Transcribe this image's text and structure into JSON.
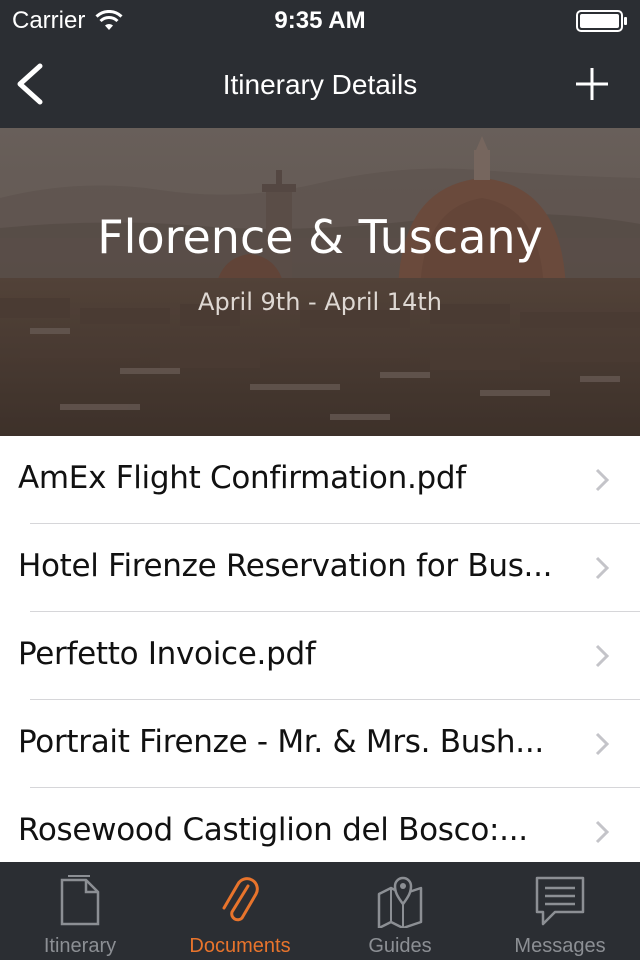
{
  "status_bar": {
    "carrier": "Carrier",
    "time": "9:35 AM"
  },
  "nav": {
    "title": "Itinerary Details"
  },
  "hero": {
    "title": "Florence & Tuscany",
    "dates": "April 9th - April 14th"
  },
  "documents": [
    {
      "label": "AmEx Flight Confirmation.pdf"
    },
    {
      "label": "Hotel Firenze Reservation for Bus..."
    },
    {
      "label": "Perfetto Invoice.pdf"
    },
    {
      "label": "Portrait Firenze - Mr. & Mrs. Bush..."
    },
    {
      "label": "Rosewood Castiglion del Bosco:..."
    }
  ],
  "tabs": [
    {
      "label": "Itinerary",
      "icon": "document-icon",
      "active": false
    },
    {
      "label": "Documents",
      "icon": "paperclip-icon",
      "active": true
    },
    {
      "label": "Guides",
      "icon": "map-pin-icon",
      "active": false
    },
    {
      "label": "Messages",
      "icon": "chat-bubble-icon",
      "active": false
    }
  ],
  "colors": {
    "bar_background": "#2b2e33",
    "accent": "#e8742c",
    "inactive_tab": "#8c8f94"
  }
}
